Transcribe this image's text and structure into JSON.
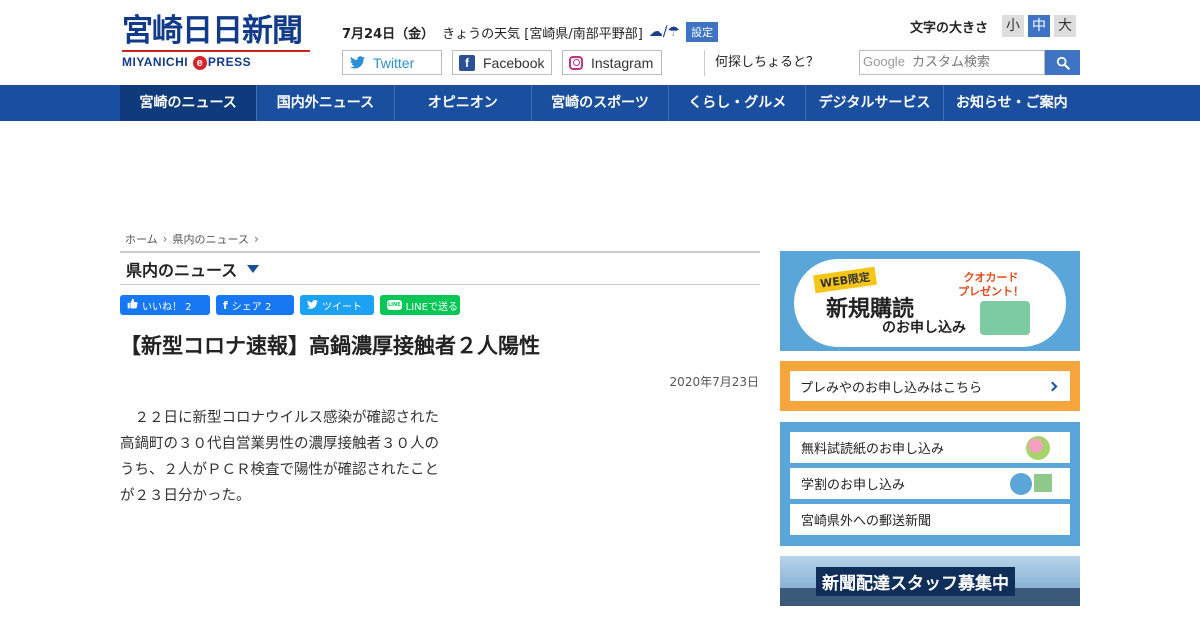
{
  "header": {
    "logo_main": "宮崎日日新聞",
    "logo_sub_before": "MIYANICHI ",
    "logo_sub_e": "e",
    "logo_sub_after": "PRESS",
    "date": "7月24日（金）",
    "weather_text": "きょうの天気 [宮崎県/南部平野部]",
    "weather_icons": "☁/☂",
    "setting_label": "設定",
    "font_size_label": "文字の大きさ",
    "font_size_small": "小",
    "font_size_medium": "中",
    "font_size_large": "大",
    "twitter_label": "Twitter",
    "facebook_label": "Facebook",
    "facebook_icon": "f",
    "instagram_label": "Instagram",
    "ask_label": "何探しちょると？",
    "search_brand": "Google",
    "search_placeholder": "カスタム検索"
  },
  "nav": {
    "items": [
      "宮崎のニュース",
      "国内外ニュース",
      "オピニオン",
      "宮崎のスポーツ",
      "くらし・グルメ",
      "デジタルサービス",
      "お知らせ・ご案内"
    ]
  },
  "breadcrumb": {
    "home": "ホーム",
    "current": "県内のニュース",
    "sep": "›"
  },
  "section": {
    "title": "県内のニュース"
  },
  "share": {
    "like": "いいね！ 2",
    "fb_share": "シェア 2",
    "fb_share_icon": "f",
    "tweet": "ツイート",
    "line": "LINEで送る",
    "line_icon": "LINE"
  },
  "article": {
    "title": "【新型コロナ速報】高鍋濃厚接触者２人陽性",
    "date": "2020年7月23日",
    "body": "２２日に新型コロナウイルス感染が確認された高鍋町の３０代自営業男性の濃厚接触者３０人のうち、２人がＰＣＲ検査で陽性が確認されたことが２３日分かった。"
  },
  "sidebar": {
    "subscribe_web": "WEB限定",
    "subscribe_big": "新規購読",
    "subscribe_small": "のお申し込み",
    "quocard_line1": "クオカード",
    "quocard_line2": "プレゼント！",
    "premium": "プレみやのお申し込みはこちら",
    "links": [
      "無料試読紙のお申し込み",
      "学割のお申し込み",
      "宮崎県外への郵送新聞"
    ],
    "recruit": "新聞配達スタッフ募集中"
  },
  "colors": {
    "nav_bg": "#1a4e9e",
    "accent_blue": "#3f74c4",
    "sidebar_blue": "#5aa6d8",
    "premium_orange": "#f6a53c"
  }
}
